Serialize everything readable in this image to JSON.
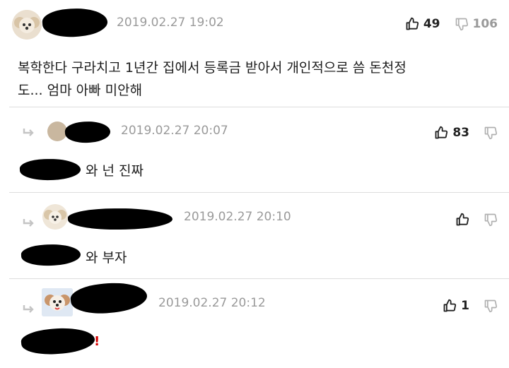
{
  "comments": [
    {
      "timestamp": "2019.02.27 19:02",
      "text_line1": "복학한다 구라치고 1년간 집에서 등록금 받아서 개인적으로 씀 돈천정",
      "text_line2": "도... 엄마 아빠 미안해",
      "upvotes": "49",
      "downvotes": "106"
    },
    {
      "timestamp": "2019.02.27 20:07",
      "text": "와 넌 진짜",
      "upvotes": "83",
      "downvotes": ""
    },
    {
      "timestamp": "2019.02.27 20:10",
      "text": "와 부자",
      "upvotes": "",
      "downvotes": ""
    },
    {
      "timestamp": "2019.02.27 20:12",
      "text": "!",
      "upvotes": "1",
      "downvotes": ""
    }
  ],
  "icons": {
    "reply": "reply-arrow-icon",
    "up": "thumbs-up-icon",
    "down": "thumbs-down-icon"
  },
  "colors": {
    "redaction": "#000000",
    "accent_red": "#d40000",
    "timestamp": "#9a9a9a"
  }
}
